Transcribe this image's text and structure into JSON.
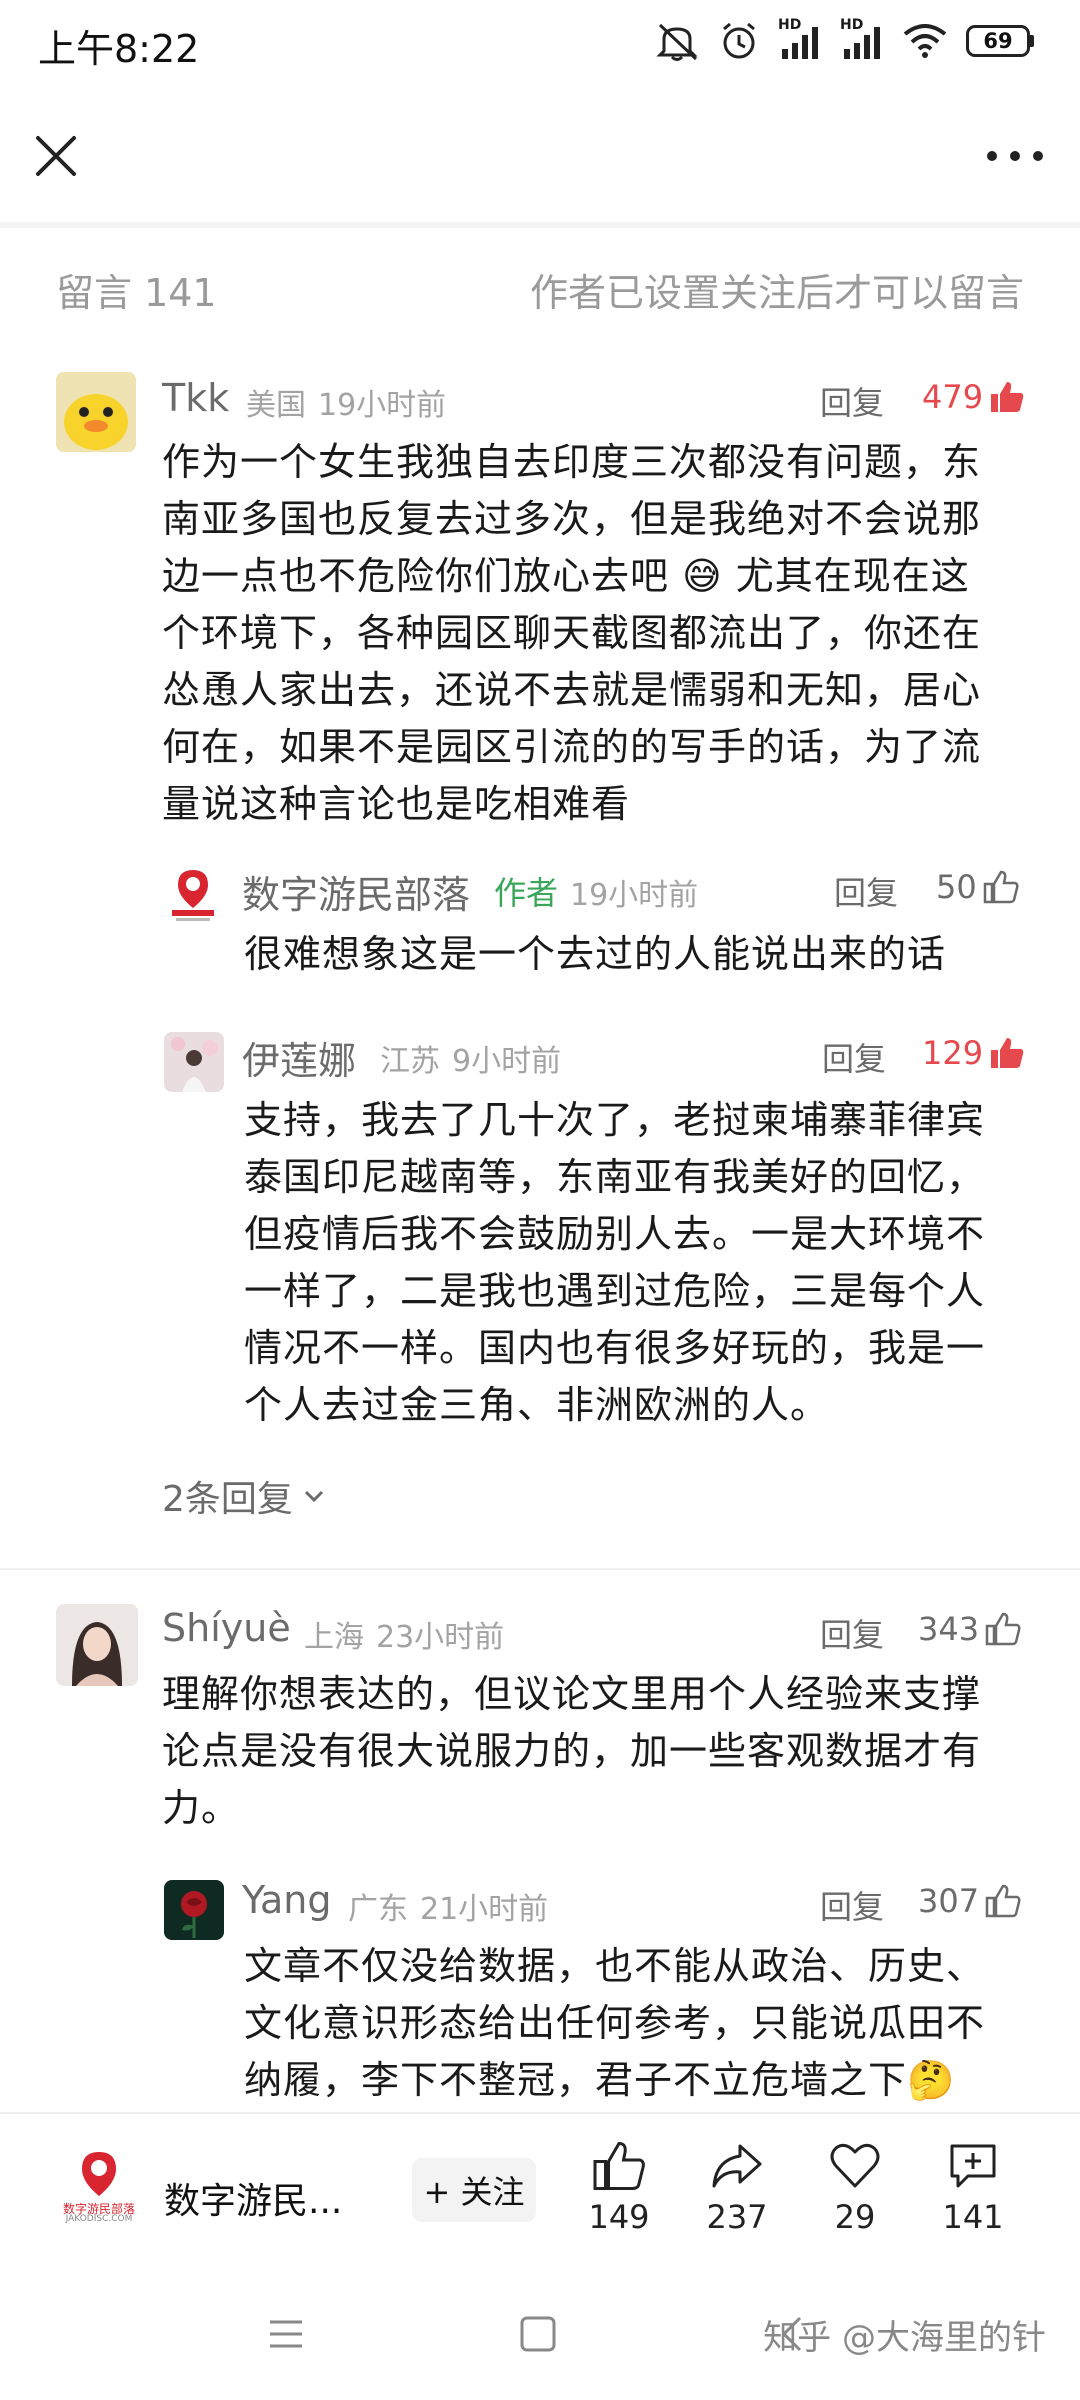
{
  "status_bar": {
    "time": "上午8:22",
    "battery": "69",
    "hd_label_1": "HD",
    "hd_label_2": "HD",
    "icons": [
      "mute-icon",
      "alarm-icon",
      "signal-icon",
      "signal-icon",
      "wifi-icon",
      "battery-icon"
    ]
  },
  "nav": {
    "close_icon": "close-icon",
    "more_icon": "more-icon"
  },
  "comments": {
    "title": "留言 141",
    "notice": "作者已设置关注后才可以留言",
    "reply_label": "回复",
    "items": [
      {
        "name": "Tkk",
        "location": "美国",
        "time": "19小时前",
        "likes": "479",
        "liked": true,
        "lines": [
          "作为一个女生我独自去印度三次都没有问题，东",
          "南亚多国也反复去过多次，但是我绝对不会说那",
          "边一点也不危险你们放心去吧 😅 尤其在现在这",
          "个环境下，各种园区聊天截图都流出了，你还在",
          "怂恿人家出去，还说不去就是懦弱和无知，居心",
          "何在，如果不是园区引流的的写手的话，为了流",
          "量说这种言论也是吃相难看"
        ]
      },
      {
        "name": "数字游民部落",
        "tag": "作者",
        "time": "19小时前",
        "likes": "50",
        "liked": false,
        "logo_text": "数字游民部落",
        "logo_sub": "JAKODISC.COM",
        "lines": [
          "很难想象这是一个去过的人能说出来的话"
        ]
      },
      {
        "name": "伊莲娜",
        "location": "江苏",
        "time": "9小时前",
        "likes": "129",
        "liked": true,
        "lines": [
          "支持，我去了几十次了，老挝柬埔寨菲律宾",
          "泰国印尼越南等，东南亚有我美好的回忆，",
          "但疫情后我不会鼓励别人去。一是大环境不",
          "一样了，二是我也遇到过危险，三是每个人",
          "情况不一样。国内也有很多好玩的，我是一",
          "个人去过金三角、非洲欧洲的人。"
        ]
      },
      {
        "name": "Shíyuè",
        "location": "上海",
        "time": "23小时前",
        "likes": "343",
        "liked": false,
        "lines": [
          "理解你想表达的，但议论文里用个人经验来支撑",
          "论点是没有很大说服力的，加一些客观数据才有",
          "力。"
        ]
      },
      {
        "name": "Yang",
        "location": "广东",
        "time": "21小时前",
        "likes": "307",
        "liked": false,
        "lines": [
          "文章不仅没给数据，也不能从政治、历史、",
          "文化意识形态给出任何参考，只能说瓜田不",
          "纳履，李下不整冠，君子不立危墙之下🤔"
        ]
      }
    ],
    "expand_replies": "2条回复"
  },
  "action_bar": {
    "author_short": "数字游民...",
    "follow_label": "+ 关注",
    "logo_text": "数字游民部落",
    "logo_sub": "JAKODISC.COM",
    "likes": "149",
    "shares": "237",
    "favorites": "29",
    "comments": "141"
  },
  "system_nav": {
    "watermark": "知乎 @大海里的针"
  },
  "colors": {
    "accent_red": "#e5484d",
    "author_green": "#3aa65a",
    "muted_gray": "#9a9a9a"
  }
}
